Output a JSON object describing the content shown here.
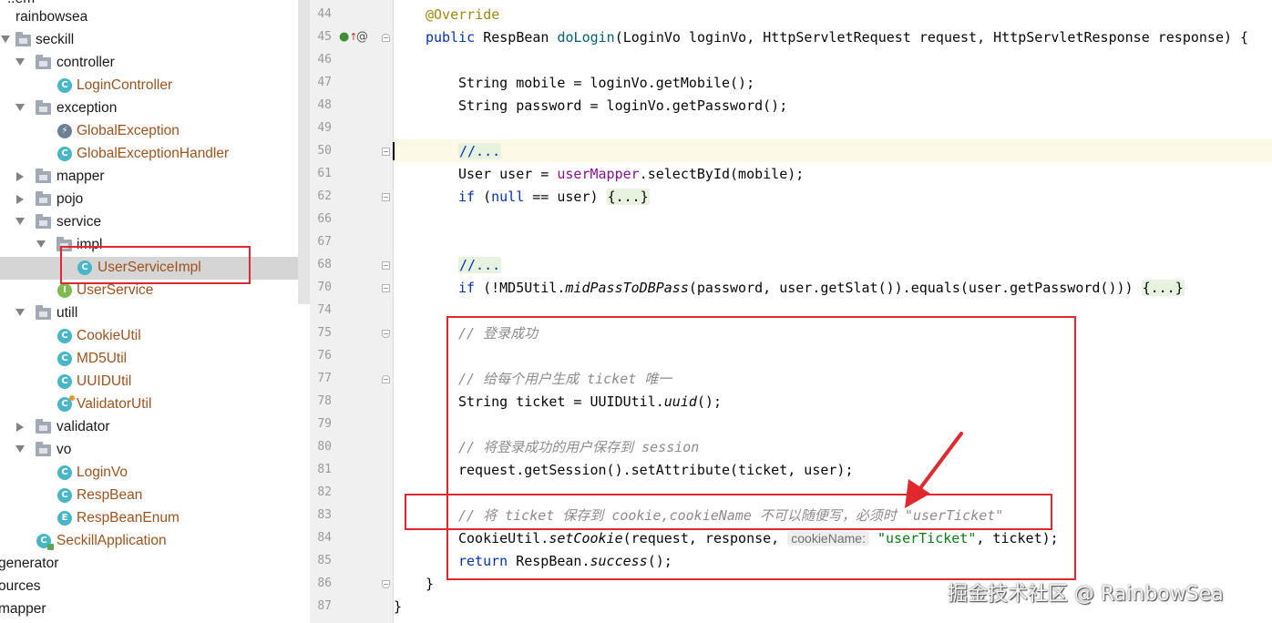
{
  "tree": {
    "items": [
      {
        "label": "rainbowsea"
      },
      {
        "label": "seckill"
      },
      {
        "label": "controller"
      },
      {
        "label": "LoginController"
      },
      {
        "label": "exception"
      },
      {
        "label": "GlobalException"
      },
      {
        "label": "GlobalExceptionHandler"
      },
      {
        "label": "mapper"
      },
      {
        "label": "pojo"
      },
      {
        "label": "service"
      },
      {
        "label": "impl"
      },
      {
        "label": "UserServiceImpl"
      },
      {
        "label": "UserService"
      },
      {
        "label": "utill"
      },
      {
        "label": "CookieUtil"
      },
      {
        "label": "MD5Util"
      },
      {
        "label": "UUIDUtil"
      },
      {
        "label": "ValidatorUtil"
      },
      {
        "label": "validator"
      },
      {
        "label": "vo"
      },
      {
        "label": "LoginVo"
      },
      {
        "label": "RespBean"
      },
      {
        "label": "RespBeanEnum"
      },
      {
        "label": "SeckillApplication"
      },
      {
        "label": "generator"
      },
      {
        "label": "ources"
      },
      {
        "label": "mapper"
      }
    ],
    "top_partial_label": "..em",
    "icon_letters": {
      "class": "C",
      "interface": "I",
      "enum": "E"
    }
  },
  "editor": {
    "line_numbers": [
      "44",
      "45",
      "46",
      "47",
      "48",
      "49",
      "50",
      "61",
      "62",
      "66",
      "67",
      "68",
      "70",
      "74",
      "75",
      "76",
      "77",
      "78",
      "79",
      "80",
      "81",
      "82",
      "83",
      "84",
      "85",
      "86",
      "87"
    ],
    "code": {
      "l44": "@Override",
      "l45_kw1": "public",
      "l45_type": " RespBean ",
      "l45_fn": "doLogin",
      "l45_rest": "(LoginVo loginVo, HttpServletRequest request, HttpServletResponse response) {",
      "l47": "String mobile = loginVo.getMobile();",
      "l48": "String password = loginVo.getPassword();",
      "l50_fold": "//...",
      "l61_a": "User user = ",
      "l61_fld": "userMapper",
      "l61_b": ".selectById(mobile);",
      "l62_kw": "if",
      "l62_a": " (",
      "l62_null": "null",
      "l62_b": " == user) ",
      "l62_fold": "{...}",
      "l68_fold": "//...",
      "l70_kw": "if",
      "l70_a": " (!MD5Util.",
      "l70_it": "midPassToDBPass",
      "l70_b": "(password, user.getSlat()).equals(user.getPassword())) ",
      "l70_fold": "{...}",
      "l75": "// 登录成功",
      "l77": "// 给每个用户生成 ticket 唯一",
      "l78_a": "String ticket = UUIDUtil.",
      "l78_it": "uuid",
      "l78_b": "();",
      "l80": "// 将登录成功的用户保存到 session",
      "l81": "request.getSession().setAttribute(ticket, user);",
      "l83": "// 将 ticket 保存到 cookie,cookieName 不可以随便写，必须时 \"userTicket\"",
      "l84_a": "CookieUtil.",
      "l84_it": "setCookie",
      "l84_b": "(request, response, ",
      "l84_hint": "cookieName:",
      "l84_str": "\"userTicket\"",
      "l84_c": ", ticket);",
      "l85_kw": "return",
      "l85_a": " RespBean.",
      "l85_it": "success",
      "l85_b": "();",
      "l86": "}",
      "l87": "}"
    }
  },
  "gutter_icons": {
    "override": "override-icon",
    "at": "@"
  },
  "watermark": "掘金技术社区 @ RainbowSea",
  "colors": {
    "highlight_box": "#e0282e",
    "keyword": "#0033b3",
    "annotation": "#9e880d",
    "comment": "#8c8c8c",
    "string": "#067d17",
    "field": "#871094"
  }
}
